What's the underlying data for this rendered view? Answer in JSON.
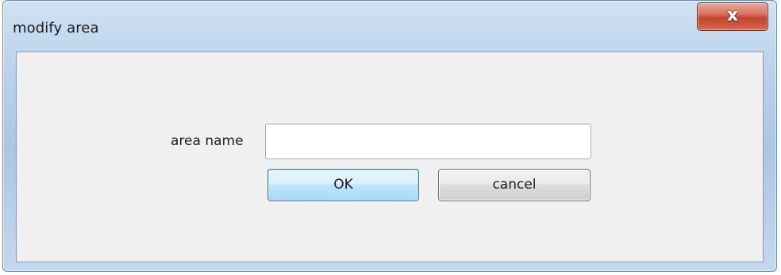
{
  "window": {
    "title": "modify area",
    "close_glyph": "x"
  },
  "form": {
    "area_name_label": "area name",
    "area_name_value": "",
    "area_name_placeholder": ""
  },
  "buttons": {
    "ok_label": "OK",
    "cancel_label": "cancel"
  },
  "colors": {
    "titlebar": "#b9d1ea",
    "client_bg": "#f0f0f0",
    "close_red": "#c4442f",
    "ok_border": "#3c7fb1"
  },
  "icons": {
    "close": "close-icon"
  }
}
